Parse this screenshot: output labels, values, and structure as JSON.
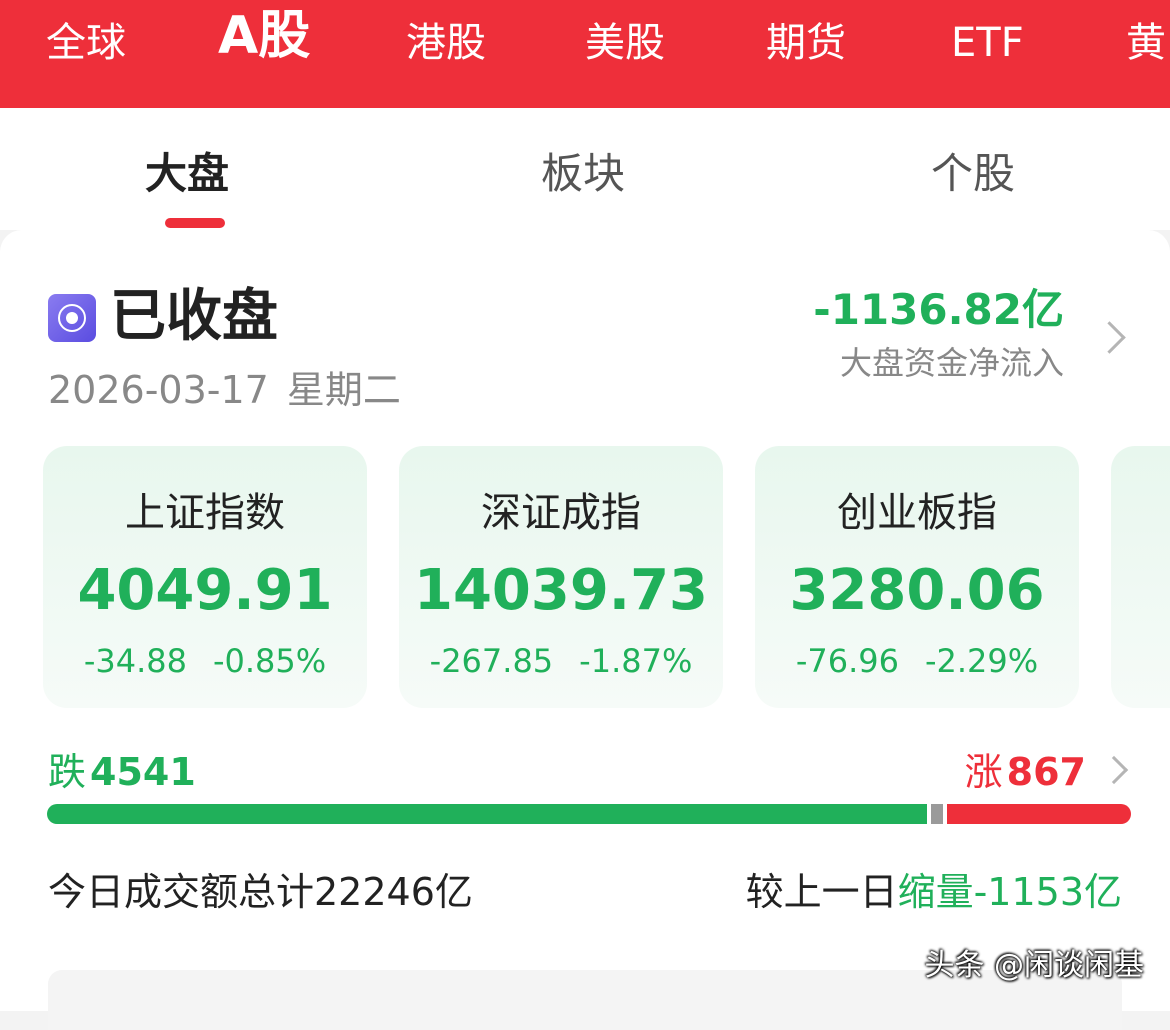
{
  "market_tabs": [
    "全球",
    "A股",
    "港股",
    "美股",
    "期货",
    "ETF",
    "黄"
  ],
  "sub_tabs": [
    "大盘",
    "板块",
    "个股"
  ],
  "status": {
    "label": "已收盘",
    "date": "2026-03-17",
    "weekday": "星期二"
  },
  "net_flow": {
    "value": "-1136.82亿",
    "label": "大盘资金净流入"
  },
  "indices": [
    {
      "name": "上证指数",
      "value": "4049.91",
      "change": "-34.88",
      "pct": "-0.85%"
    },
    {
      "name": "深证成指",
      "value": "14039.73",
      "change": "-267.85",
      "pct": "-1.87%"
    },
    {
      "name": "创业板指",
      "value": "3280.06",
      "change": "-76.96",
      "pct": "-2.29%"
    }
  ],
  "breadth": {
    "fall_label": "跌",
    "fall_count": "4541",
    "rise_label": "涨",
    "rise_count": "867",
    "fall_ratio": 0.823
  },
  "turnover": {
    "text": "今日成交额总计22246亿",
    "compare_prefix": "较上一日",
    "compare_value": "缩量-1153亿"
  },
  "watermark": "头条 @闲谈闲基",
  "colors": {
    "brand_red": "#ee2f3a",
    "down_green": "#20b05a"
  }
}
